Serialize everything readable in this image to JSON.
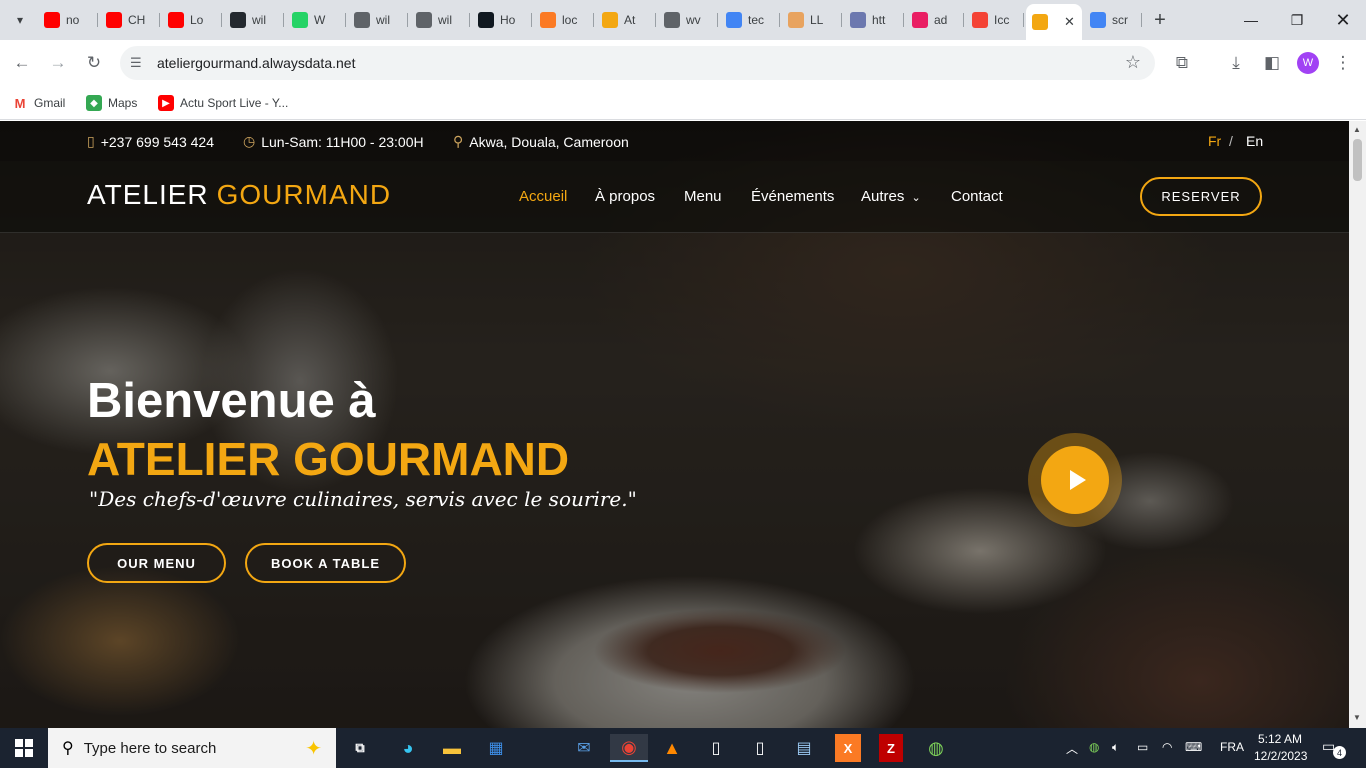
{
  "browser": {
    "tabs": [
      {
        "label": "no",
        "icon": "youtube-icon",
        "color": "#ff0000"
      },
      {
        "label": "CH",
        "icon": "youtube-icon",
        "color": "#ff0000"
      },
      {
        "label": "Lo",
        "icon": "youtube-icon",
        "color": "#ff0000"
      },
      {
        "label": "wil",
        "icon": "github-icon",
        "color": "#24292f"
      },
      {
        "label": "W",
        "icon": "whatsapp-icon",
        "color": "#25d366"
      },
      {
        "label": "wil",
        "icon": "globe-icon",
        "color": "#5f6368"
      },
      {
        "label": "wil",
        "icon": "globe-icon",
        "color": "#5f6368"
      },
      {
        "label": "Ho",
        "icon": "appsource-icon",
        "color": "#101820"
      },
      {
        "label": "loc",
        "icon": "xampp-icon",
        "color": "#fb7a24"
      },
      {
        "label": "At",
        "icon": "atelier-icon",
        "color": "#f3a712"
      },
      {
        "label": "wv",
        "icon": "globe-icon",
        "color": "#5f6368"
      },
      {
        "label": "tec",
        "icon": "google-icon",
        "color": "#4285f4"
      },
      {
        "label": "LL",
        "icon": "box-icon",
        "color": "#e8a35f"
      },
      {
        "label": "htt",
        "icon": "phpmyadmin-icon",
        "color": "#6c78af"
      },
      {
        "label": "ad",
        "icon": "analytics-icon",
        "color": "#e91e63"
      },
      {
        "label": "Icc",
        "icon": "analytics-icon",
        "color": "#f44336"
      },
      {
        "label": "",
        "icon": "atelier-icon",
        "color": "#f3a712",
        "active": true
      },
      {
        "label": "scr",
        "icon": "google-icon",
        "color": "#4285f4"
      }
    ],
    "url": "ateliergourmand.alwaysdata.net",
    "profile_initial": "W",
    "bookmarks": [
      {
        "label": "Gmail",
        "icon": "gmail-icon",
        "color": "#ea4335"
      },
      {
        "label": "Maps",
        "icon": "maps-icon",
        "color": "#34a853"
      },
      {
        "label": "Actu Sport Live - Y...",
        "icon": "youtube-icon",
        "color": "#ff0000"
      }
    ]
  },
  "site": {
    "topbar": {
      "phone": "+237 699 543 424",
      "hours": "Lun-Sam: 11H00 - 23:00H",
      "address": "Akwa, Douala, Cameroon",
      "lang_fr": "Fr",
      "lang_sep": "/",
      "lang_en": "En"
    },
    "logo": {
      "part1": "ATELIER",
      "part2": "GOURMAND"
    },
    "nav": {
      "home": "Accueil",
      "about": "À propos",
      "menu": "Menu",
      "events": "Événements",
      "others": "Autres",
      "contact": "Contact"
    },
    "reserve_button": "RESERVER",
    "hero": {
      "title_line1": "Bienvenue à",
      "title_line2": "ATELIER GOURMAND",
      "quote": "\"Des chefs-d'œuvre culinaires, servis avec le sourire.\"",
      "menu_button": "OUR MENU",
      "book_button": "BOOK A TABLE"
    },
    "colors": {
      "accent": "#f3a712"
    }
  },
  "taskbar": {
    "search_placeholder": "Type here to search",
    "language": "FRA",
    "time": "5:12 AM",
    "date": "12/2/2023",
    "notification_count": "4"
  }
}
